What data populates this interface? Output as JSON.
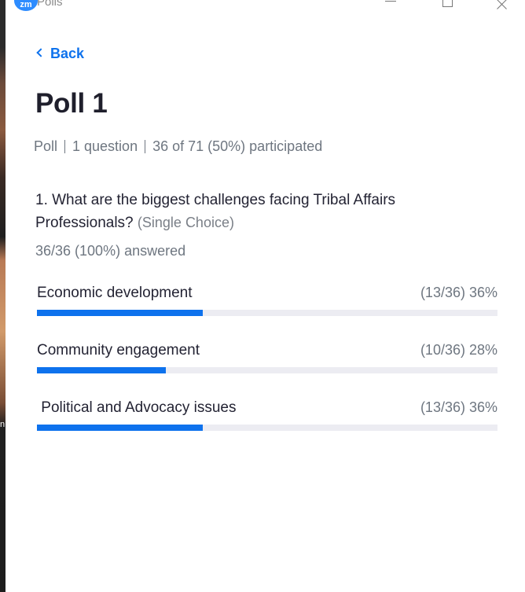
{
  "window": {
    "title": "Polls",
    "app_icon_text": "zm"
  },
  "nav": {
    "back_label": "Back"
  },
  "poll": {
    "title": "Poll 1",
    "meta": {
      "type": "Poll",
      "questions": "1 question",
      "participation": "36 of 71 (50%) participated"
    },
    "question": {
      "text": "1. What are the biggest challenges facing Tribal Affairs Professionals?",
      "type": "(Single Choice)",
      "answered": "36/36 (100%) answered"
    },
    "options": [
      {
        "label": "Economic development",
        "result": "(13/36) 36%",
        "fraction": 0.36
      },
      {
        "label": "Community engagement",
        "result": "(10/36) 28%",
        "fraction": 0.28
      },
      {
        "label": " Political and Advocacy issues",
        "result": "(13/36) 36%",
        "fraction": 0.36
      }
    ]
  },
  "colors": {
    "accent": "#0e72ed",
    "track": "#ececf2"
  }
}
